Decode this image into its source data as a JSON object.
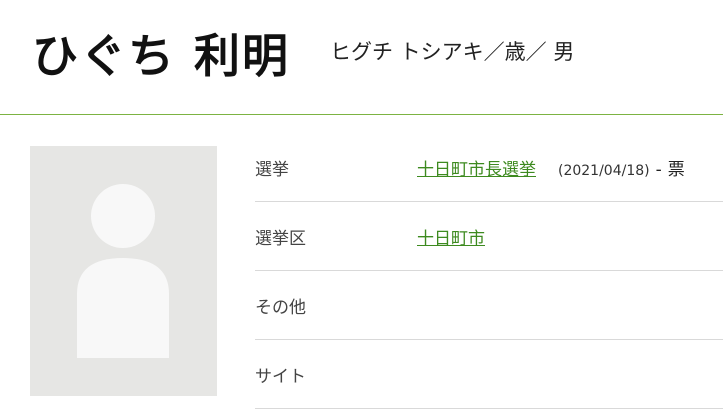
{
  "profile": {
    "name": "ひぐち 利明",
    "subtitle": "ヒグチ トシアキ／歳／ 男"
  },
  "details": {
    "rows": [
      {
        "label": "選挙",
        "link": "十日町市長選挙",
        "date": "(2021/04/18)",
        "dash": "-",
        "votes": "票"
      },
      {
        "label": "選挙区",
        "link": "十日町市"
      },
      {
        "label": "その他"
      },
      {
        "label": "サイト"
      }
    ]
  },
  "colors": {
    "accent": "#7cb342",
    "link": "#3d8a1f",
    "avatar_bg": "#e6e6e4",
    "avatar_fg": "#f8f8f8"
  },
  "icons": {
    "avatar": "person-silhouette-icon"
  }
}
